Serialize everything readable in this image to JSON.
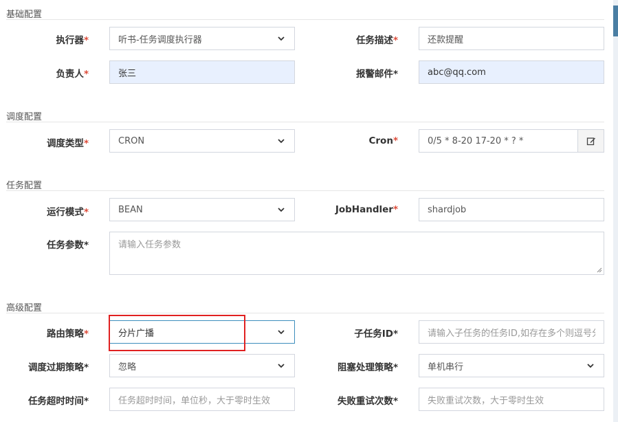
{
  "sections": {
    "basic": "基础配置",
    "schedule": "调度配置",
    "task": "任务配置",
    "advanced": "高级配置"
  },
  "required_mark": "*",
  "fields": {
    "executor": {
      "label": "执行器",
      "value": "听书-任务调度执行器"
    },
    "task_desc": {
      "label": "任务描述",
      "value": "还款提醒"
    },
    "owner": {
      "label": "负责人",
      "value": "张三"
    },
    "alarm_email": {
      "label": "报警邮件",
      "value": "abc@qq.com"
    },
    "schedule_type": {
      "label": "调度类型",
      "value": "CRON"
    },
    "cron": {
      "label": "Cron",
      "value": "0/5 * 8-20 17-20 * ? *"
    },
    "run_mode": {
      "label": "运行模式",
      "value": "BEAN"
    },
    "job_handler": {
      "label": "JobHandler",
      "value": "shardjob"
    },
    "task_params": {
      "label": "任务参数",
      "placeholder": "请输入任务参数"
    },
    "route_strategy": {
      "label": "路由策略",
      "value": "分片广播"
    },
    "child_job_id": {
      "label": "子任务ID",
      "placeholder": "请输入子任务的任务ID,如存在多个则逗号分隔"
    },
    "misfire_strategy": {
      "label": "调度过期策略",
      "value": "忽略"
    },
    "block_strategy": {
      "label": "阻塞处理策略",
      "value": "单机串行"
    },
    "timeout": {
      "label": "任务超时时间",
      "placeholder": "任务超时时间，单位秒，大于零时生效"
    },
    "retry_count": {
      "label": "失败重试次数",
      "placeholder": "失败重试次数，大于零时生效"
    }
  },
  "colors": {
    "required": "#dd4b39",
    "highlight_box": "#e02020",
    "autofill": "#e8f0fe",
    "focus": "#3c8dbc"
  },
  "icons": {
    "select_arrow": "chevron-down-icon",
    "cron_button": "edit-icon"
  }
}
